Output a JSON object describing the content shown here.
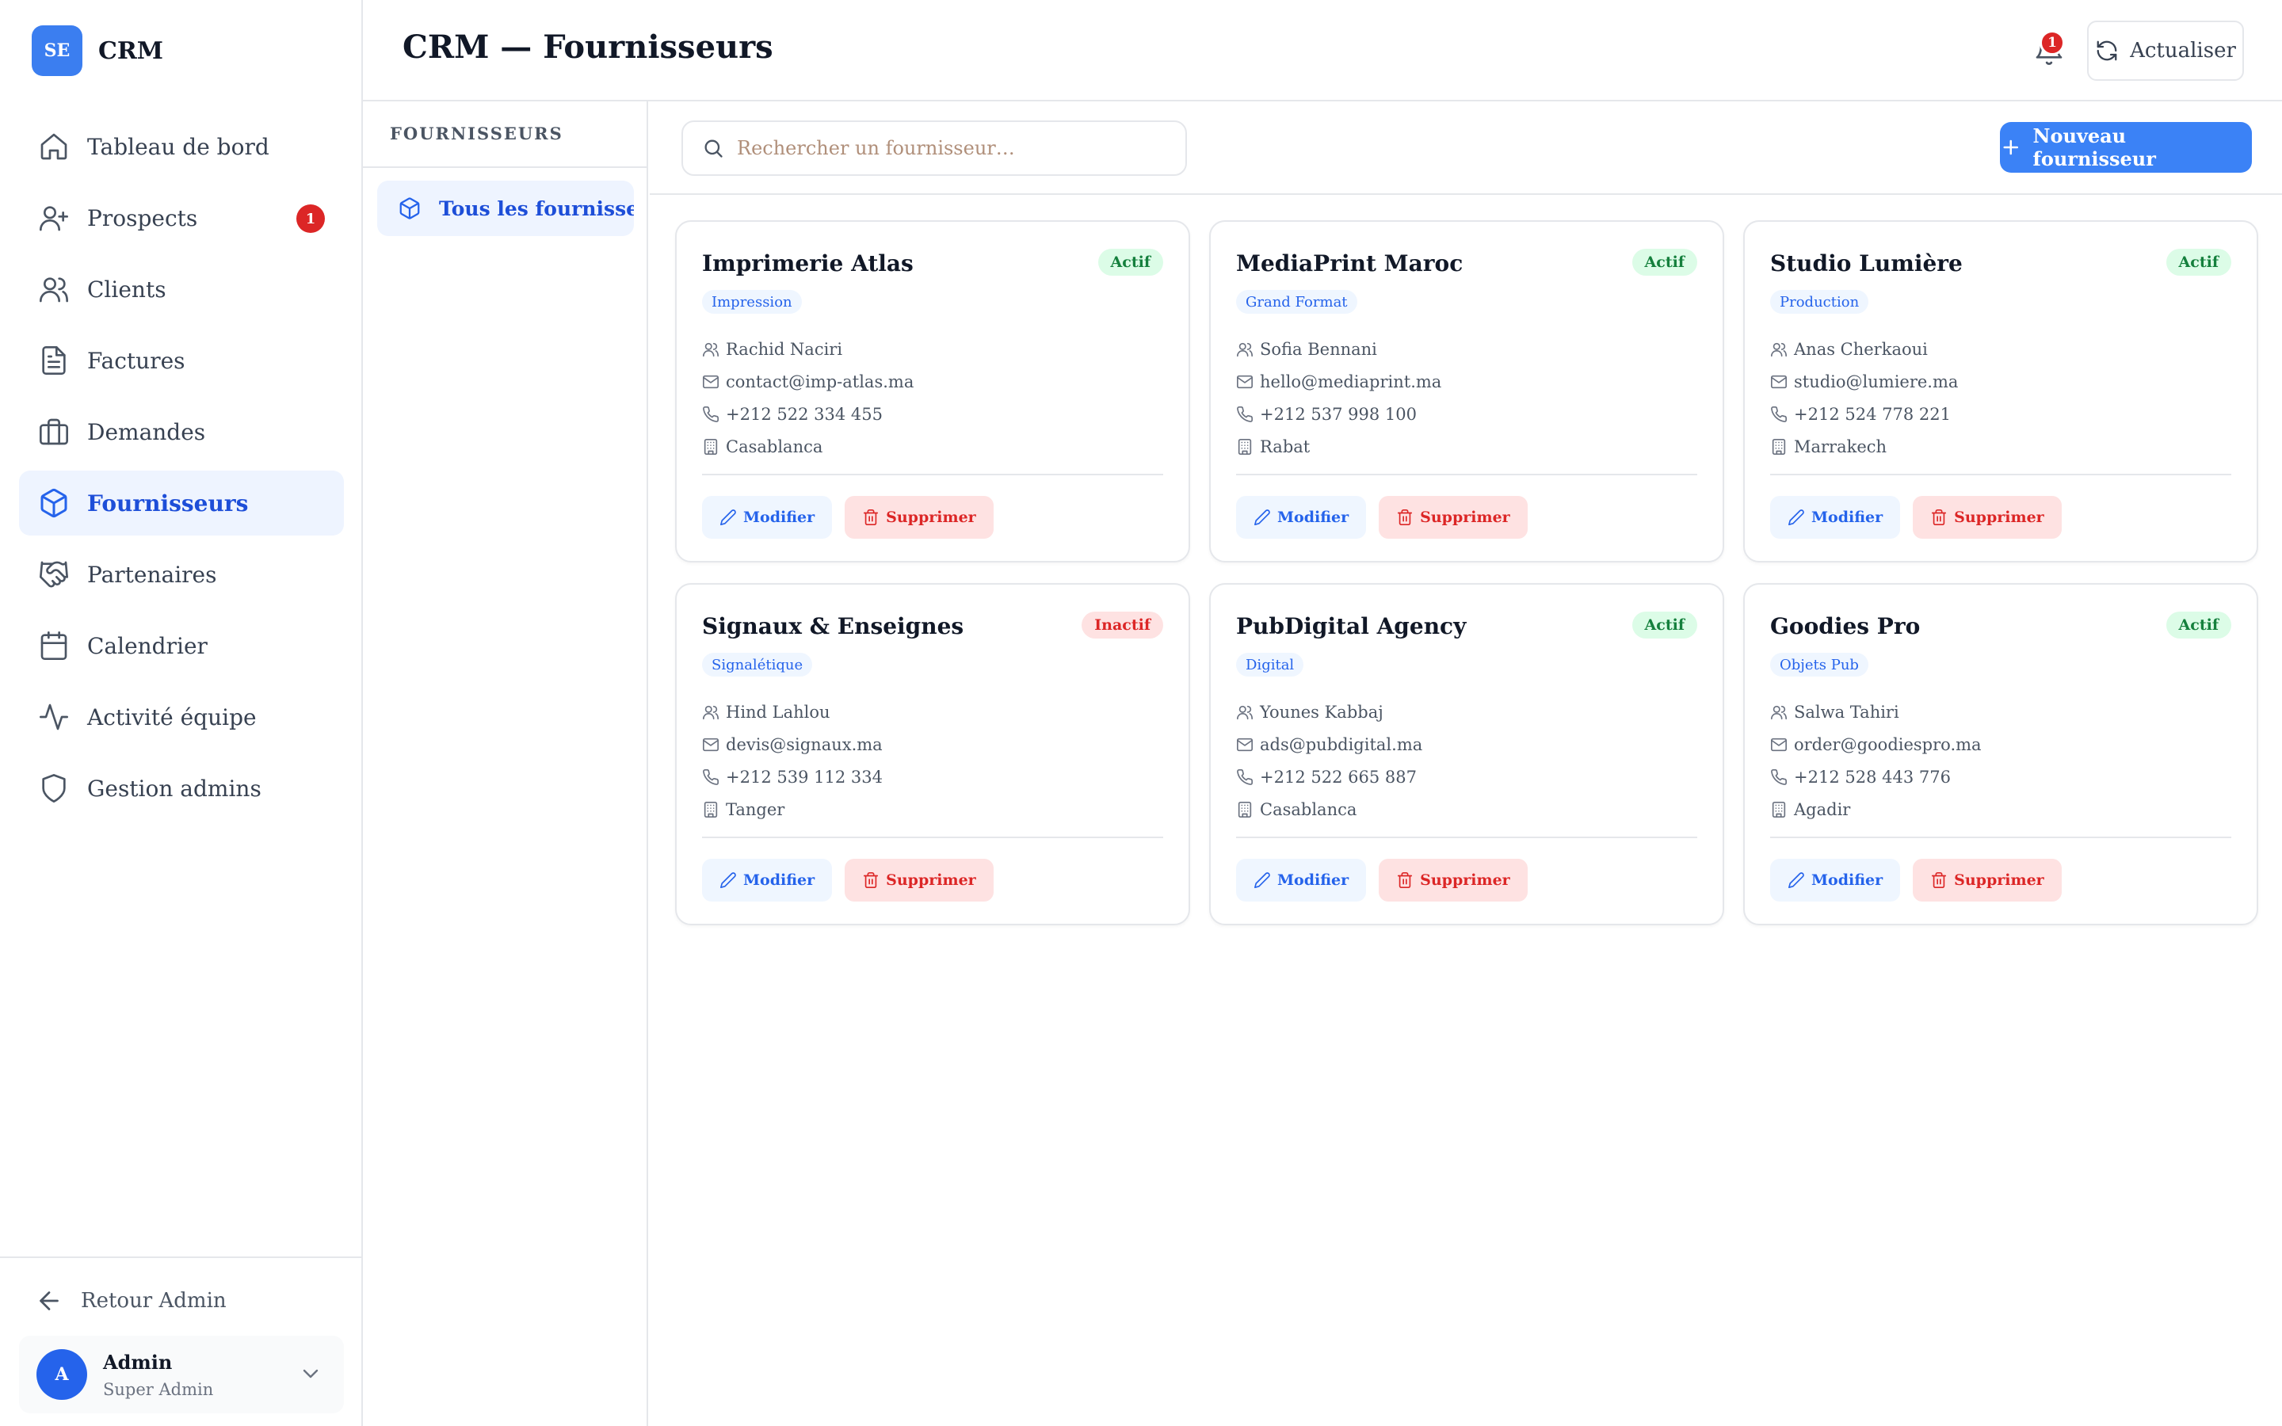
{
  "sidebar": {
    "brand_logo": "SE",
    "brand_name": "CRM",
    "items": [
      {
        "label": "Tableau de bord",
        "icon": "home-icon"
      },
      {
        "label": "Prospects",
        "icon": "user-plus-icon",
        "badge": "1"
      },
      {
        "label": "Clients",
        "icon": "users-icon"
      },
      {
        "label": "Factures",
        "icon": "file-text-icon"
      },
      {
        "label": "Demandes",
        "icon": "briefcase-icon"
      },
      {
        "label": "Fournisseurs",
        "icon": "package-icon",
        "active": true
      },
      {
        "label": "Partenaires",
        "icon": "handshake-icon"
      },
      {
        "label": "Calendrier",
        "icon": "calendar-icon"
      },
      {
        "label": "Activité équipe",
        "icon": "activity-icon"
      },
      {
        "label": "Gestion admins",
        "icon": "shield-icon"
      }
    ],
    "back_label": "Retour Admin",
    "user": {
      "initial": "A",
      "name": "Admin",
      "role": "Super Admin"
    }
  },
  "header": {
    "title": "CRM — Fournisseurs",
    "notification_count": "1",
    "refresh_label": "Actualiser"
  },
  "categories": {
    "title": "FOURNISSEURS",
    "items": [
      {
        "label": "Tous les fournisse…",
        "active": true
      }
    ]
  },
  "toolbar": {
    "search_placeholder": "Rechercher un fournisseur…",
    "new_label": "Nouveau fournisseur"
  },
  "suppliers": [
    {
      "name": "Imprimerie Atlas",
      "status": "Actif",
      "tag": "Impression",
      "contact": "Rachid Naciri",
      "email": "contact@imp-atlas.ma",
      "phone": "+212 522 334 455",
      "city": "Casablanca"
    },
    {
      "name": "MediaPrint Maroc",
      "status": "Actif",
      "tag": "Grand Format",
      "contact": "Sofia Bennani",
      "email": "hello@mediaprint.ma",
      "phone": "+212 537 998 100",
      "city": "Rabat"
    },
    {
      "name": "Studio Lumière",
      "status": "Actif",
      "tag": "Production",
      "contact": "Anas Cherkaoui",
      "email": "studio@lumiere.ma",
      "phone": "+212 524 778 221",
      "city": "Marrakech"
    },
    {
      "name": "Signaux & Enseignes",
      "status": "Inactif",
      "tag": "Signalétique",
      "contact": "Hind Lahlou",
      "email": "devis@signaux.ma",
      "phone": "+212 539 112 334",
      "city": "Tanger"
    },
    {
      "name": "PubDigital Agency",
      "status": "Actif",
      "tag": "Digital",
      "contact": "Younes Kabbaj",
      "email": "ads@pubdigital.ma",
      "phone": "+212 522 665 887",
      "city": "Casablanca"
    },
    {
      "name": "Goodies Pro",
      "status": "Actif",
      "tag": "Objets Pub",
      "contact": "Salwa Tahiri",
      "email": "order@goodiespro.ma",
      "phone": "+212 528 443 776",
      "city": "Agadir"
    }
  ],
  "card_actions": {
    "edit_label": "Modifier",
    "delete_label": "Supprimer"
  },
  "colors": {
    "accent": "#3b82f6",
    "active_bg": "#eef4ff",
    "success": "#15803d",
    "danger": "#dc2626"
  }
}
